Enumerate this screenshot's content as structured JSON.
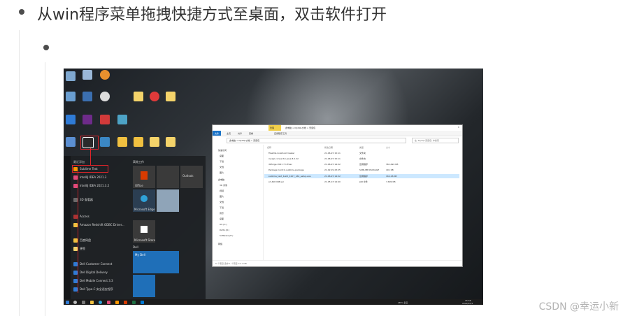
{
  "heading": "从win程序菜单拖拽快捷方式至桌面，双击软件打开",
  "watermark": "CSDN @幸运小新",
  "screenshot": {
    "start_menu": {
      "header": "最近添加",
      "items": [
        "Sublime Text",
        "IntelliJ IDEA 2021.3",
        "IntelliJ IDEA 2021.3.2",
        "IntelliJ IDEA",
        "3D 查看器",
        "Access",
        "Amazon Redshift ODBC Driver...",
        "百度网盘",
        "便签",
        "Dell",
        "Dell Customer Connect",
        "Dell Digital Delivery",
        "Dell Mobile Connect 3.3",
        "Dell Type-C 安全适应程序"
      ],
      "tile_group": "高效工作",
      "tiles": [
        "Office",
        "Microsoft Edge",
        "Microsoft Store",
        "My Dell",
        "Outlook",
        "Dell"
      ]
    },
    "explorer": {
      "tabs": [
        "文件",
        "主页",
        "共享",
        "查看"
      ],
      "manage_tab": "管理",
      "ribbon_label": "应用程序工具",
      "path": "此电脑 > MySQL文档 > 安装包",
      "search_placeholder": "在 'MySQL安装包' 中搜索",
      "columns": [
        "名称",
        "修改日期",
        "类型",
        "大小"
      ],
      "nav": [
        "快速访问",
        "桌面",
        "下载",
        "文档",
        "图片",
        "此电脑",
        "3D 对象",
        "视频",
        "图片",
        "文档",
        "下载",
        "音乐",
        "桌面",
        "OS (C:)",
        "DATA (D:)",
        "Software (E:)",
        "网络"
      ],
      "files": [
        {
          "name": "FileZilla localhost master",
          "date": "21.06.25 15:11",
          "type": "文件夹",
          "size": ""
        },
        {
          "name": "mysql-connector-java-8.0.22",
          "date": "21.06.25 15:11",
          "type": "文件夹",
          "size": ""
        },
        {
          "name": "dbforge 2021 7.1 Exec",
          "date": "21.06.25 14:22",
          "type": "应用程序",
          "size": "361,624 KB"
        },
        {
          "name": "Package Control.sublime-package",
          "date": "21.02.09 23:25",
          "type": "SUBLIME-PACKAGE",
          "size": "401 KB"
        },
        {
          "name": "sublime_text_build_4107_x64_setup.exe",
          "date": "21.06.25 14:22",
          "type": "应用程序",
          "size": "16,126 KB"
        },
        {
          "name": "sh-496 64B.jar",
          "date": "21.05.03 14:40",
          "type": "JAR 文件",
          "size": "7,699 KB"
        }
      ],
      "status": "6 个项目  选中 1 个项目  16.1 MB"
    },
    "taskbar": {
      "weather": "28°C 多云",
      "time": "15:56",
      "date": "2022/10/1"
    }
  }
}
